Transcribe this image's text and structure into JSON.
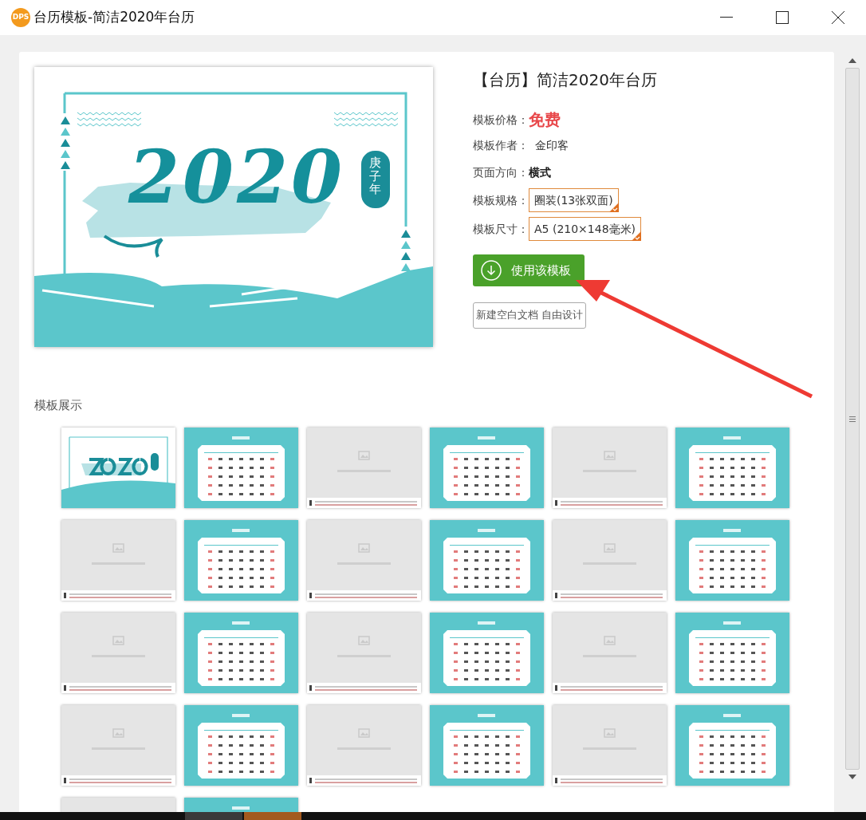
{
  "window": {
    "title": "台历模板-简洁2020年台历",
    "app_badge": "DPS"
  },
  "preview": {
    "year": "2020",
    "seal": "庚子年"
  },
  "details": {
    "title": "【台历】简洁2020年台历",
    "fields": [
      {
        "label": "模板价格：",
        "value": "免费",
        "kind": "price"
      },
      {
        "label": "模板作者：",
        "value": "金印客",
        "kind": "text"
      },
      {
        "label": "页面方向：",
        "value": "横式",
        "kind": "bold"
      },
      {
        "label": "模板规格：",
        "value": "圈装(13张双面)",
        "kind": "select"
      },
      {
        "label": "模板尺寸：",
        "value": "A5 (210×148毫米)",
        "kind": "select"
      }
    ]
  },
  "primary_button": "使用该模板",
  "secondary_button": "新建空白文档 自由设计",
  "gallery": {
    "title": "模板展示",
    "thumbnails": [
      {
        "kind": "cover"
      },
      {
        "kind": "calendar"
      },
      {
        "kind": "placeholder"
      },
      {
        "kind": "calendar"
      },
      {
        "kind": "placeholder"
      },
      {
        "kind": "calendar"
      },
      {
        "kind": "placeholder"
      },
      {
        "kind": "calendar"
      },
      {
        "kind": "placeholder"
      },
      {
        "kind": "calendar"
      },
      {
        "kind": "placeholder"
      },
      {
        "kind": "calendar"
      },
      {
        "kind": "placeholder"
      },
      {
        "kind": "calendar"
      },
      {
        "kind": "placeholder"
      },
      {
        "kind": "calendar"
      },
      {
        "kind": "placeholder"
      },
      {
        "kind": "calendar"
      },
      {
        "kind": "placeholder"
      },
      {
        "kind": "calendar"
      },
      {
        "kind": "placeholder"
      },
      {
        "kind": "calendar"
      },
      {
        "kind": "placeholder"
      },
      {
        "kind": "calendar"
      },
      {
        "kind": "placeholder"
      },
      {
        "kind": "calendar"
      }
    ]
  }
}
